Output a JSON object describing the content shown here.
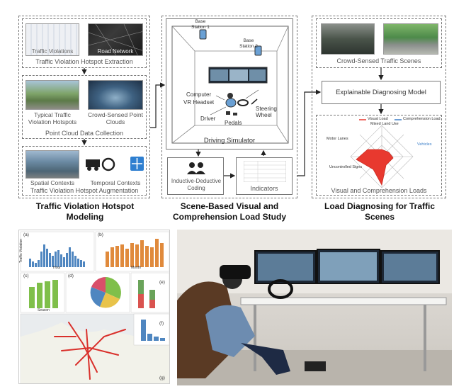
{
  "modules": {
    "extraction": {
      "thumb1": "Traffic Violations",
      "thumb2": "Road Network",
      "label": "Traffic Violation Hotspot Extraction"
    },
    "collection": {
      "thumb1": "Typical Traffic Violation Hotspots",
      "thumb2": "Crowd-Sensed Point Clouds",
      "label": "Point Cloud Data Collection"
    },
    "augmentation": {
      "thumb1": "Spatial Contexts",
      "thumb2": "Temporal Contexts",
      "label": "Traffic Violation Hotspot Augmentation"
    },
    "simulator": {
      "base1": "Base Station 1",
      "base2": "Base Station 2",
      "computer": "Computer",
      "headset": "VR Headset",
      "driver": "Driver",
      "pedals": "Pedals",
      "wheel": "Steering Wheel",
      "label": "Driving Simulator"
    },
    "coding": "Inductive-Deductive Coding",
    "indicators": "Indicators",
    "scenes": "Crowd-Sensed Traffic Scenes",
    "model": "Explainable Diagnosing Model",
    "loads": "Visual and Comprehension Loads"
  },
  "titles": {
    "left": "Traffic Violation Hotspot Modeling",
    "middle": "Scene-Based Visual and Comprehension Load Study",
    "right": "Load Diagnosing for Traffic Scenes"
  },
  "radar": {
    "legend1": "Visual Load",
    "legend2": "Comprehension Load",
    "axis_top": "Mixed Land Use",
    "axis_left": "Motor Lanes",
    "axis_right": "Vehicles",
    "axis_bottom": "Uncontrolled Signs"
  },
  "panels": {
    "a": "(a)",
    "b": "(b)",
    "c": "(c)",
    "d": "(d)",
    "e": "(e)",
    "f": "(f)",
    "g": "(g)",
    "a_x": "Hour",
    "b_x": "Month",
    "c_x": "Season",
    "ylabel": "Traffic Violation"
  },
  "colors": {
    "bar_blue": "#4f86c0",
    "bar_orange": "#e08a3c",
    "bar_green": "#7fbf4a",
    "road_red": "#d9302b",
    "radar_red": "#e8392f"
  }
}
